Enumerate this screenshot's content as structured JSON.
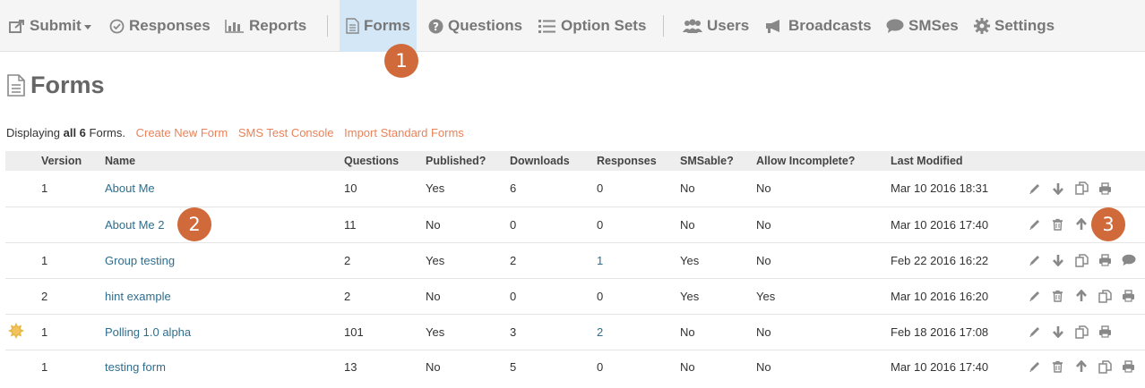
{
  "nav": {
    "submit": "Submit",
    "responses": "Responses",
    "reports": "Reports",
    "forms": "Forms",
    "questions": "Questions",
    "option_sets": "Option Sets",
    "users": "Users",
    "broadcasts": "Broadcasts",
    "smses": "SMSes",
    "settings": "Settings"
  },
  "callouts": [
    "1",
    "2",
    "3"
  ],
  "page": {
    "title": "Forms",
    "summary_prefix": "Displaying",
    "summary_count": "all 6",
    "summary_suffix": "Forms.",
    "links": [
      "Create New Form",
      "SMS Test Console",
      "Import Standard Forms"
    ]
  },
  "table": {
    "headers": [
      "Version",
      "Name",
      "Questions",
      "Published?",
      "Downloads",
      "Responses",
      "SMSable?",
      "Allow Incomplete?",
      "Last Modified"
    ],
    "rows": [
      {
        "version": "1",
        "name": "About Me",
        "questions": "10",
        "published": "Yes",
        "downloads": "6",
        "responses": "0",
        "smsable": "No",
        "incomplete": "No",
        "modified": "Mar 10 2016 18:31"
      },
      {
        "version": "",
        "name": "About Me 2",
        "questions": "11",
        "published": "No",
        "downloads": "0",
        "responses": "0",
        "smsable": "No",
        "incomplete": "No",
        "modified": "Mar 10 2016 17:40"
      },
      {
        "version": "1",
        "name": "Group testing",
        "questions": "2",
        "published": "Yes",
        "downloads": "2",
        "responses": "1",
        "smsable": "Yes",
        "incomplete": "No",
        "modified": "Feb 22 2016 16:22"
      },
      {
        "version": "2",
        "name": "hint example",
        "questions": "2",
        "published": "No",
        "downloads": "0",
        "responses": "0",
        "smsable": "Yes",
        "incomplete": "Yes",
        "modified": "Mar 10 2016 16:20"
      },
      {
        "version": "1",
        "name": "Polling 1.0 alpha",
        "questions": "101",
        "published": "Yes",
        "downloads": "3",
        "responses": "2",
        "smsable": "No",
        "incomplete": "No",
        "modified": "Feb 18 2016 17:08"
      },
      {
        "version": "1",
        "name": "testing form",
        "questions": "13",
        "published": "No",
        "downloads": "5",
        "responses": "0",
        "smsable": "No",
        "incomplete": "No",
        "modified": "Mar 10 2016 17:40"
      }
    ]
  },
  "icons": {
    "row_actions": [
      [
        "pencil-icon",
        "arrow-down-icon",
        "copy-icon",
        "print-icon"
      ],
      [
        "pencil-icon",
        "trash-icon",
        "arrow-up-icon",
        "print-icon"
      ],
      [
        "pencil-icon",
        "arrow-down-icon",
        "copy-icon",
        "print-icon",
        "comment-icon"
      ],
      [
        "pencil-icon",
        "trash-icon",
        "arrow-up-icon",
        "copy-icon",
        "print-icon"
      ],
      [
        "pencil-icon",
        "arrow-down-icon",
        "copy-icon",
        "print-icon"
      ],
      [
        "pencil-icon",
        "trash-icon",
        "arrow-up-icon",
        "copy-icon",
        "print-icon"
      ]
    ],
    "standard_form_marker": "sun-badge-icon"
  },
  "colors": {
    "nav_bg": "#f5f5f5",
    "active_tab_bg": "#d4e7f7",
    "link": "#2e6e8e",
    "action_link": "#e8835a",
    "callout": "#d06a3a",
    "icon_gray": "#888888"
  }
}
